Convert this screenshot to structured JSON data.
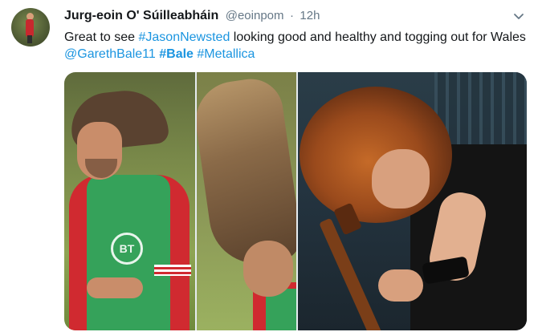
{
  "tweet": {
    "author_name": "Jurg-eoin O' Súilleabháin",
    "handle": "@eoinpom",
    "separator": "·",
    "time": "12h",
    "text": {
      "part1": "Great to see ",
      "tag_newsted": "#JasonNewsted",
      "part2": " looking good and healthy and togging out for Wales ",
      "mention_bale": "@GarethBale11",
      "space1": " ",
      "tag_bale": "#Bale",
      "space2": " ",
      "tag_metallica": "#Metallica"
    },
    "media": {
      "bib_logo": "BT"
    }
  },
  "icons": {
    "avatar": "profile-photo",
    "more": "chevron-down-icon"
  },
  "colors": {
    "link": "#1b95e0",
    "text": "#14171a",
    "muted": "#657786"
  }
}
